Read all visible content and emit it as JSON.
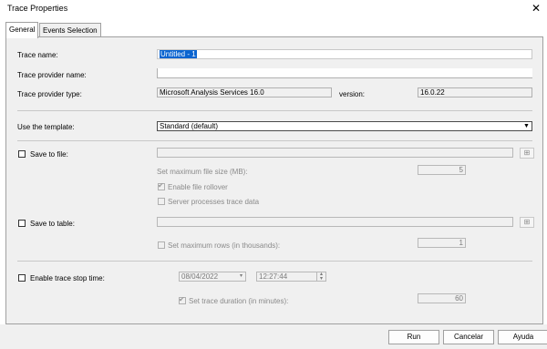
{
  "window": {
    "title": "Trace Properties"
  },
  "tabs": [
    {
      "label": "General",
      "active": true
    },
    {
      "label": "Events Selection",
      "active": false
    }
  ],
  "fields": {
    "trace_name": {
      "label": "Trace name:",
      "value": "Untitled - 1"
    },
    "trace_provider_name": {
      "label": "Trace provider name:",
      "value": ""
    },
    "trace_provider_type": {
      "label": "Trace provider type:",
      "value": "Microsoft Analysis Services 16.0"
    },
    "version": {
      "label": "version:",
      "value": "16.0.22"
    },
    "template": {
      "label": "Use the template:",
      "value": "Standard (default)"
    }
  },
  "save_to_file": {
    "label": "Save to file:",
    "checked": false,
    "max_file_size_label": "Set maximum file size (MB):",
    "max_file_size_value": "5",
    "enable_rollover_label": "Enable file rollover",
    "enable_rollover_checked": true,
    "server_processes_label": "Server processes trace data",
    "server_processes_checked": false
  },
  "save_to_table": {
    "label": "Save to table:",
    "checked": false,
    "max_rows_label": "Set maximum rows (in thousands):",
    "max_rows_value": "1"
  },
  "stop_time": {
    "label": "Enable trace stop time:",
    "checked": false,
    "date": "08/04/2022",
    "time": "12:27:44",
    "duration_label": "Set trace duration (in minutes):",
    "duration_checked": true,
    "duration_value": "60"
  },
  "buttons": {
    "run": "Run",
    "cancel": "Cancelar",
    "help": "Ayuda"
  },
  "icons": {
    "close": "close-icon",
    "dropdown": "chevron-down-icon",
    "browse": "browse-icon"
  }
}
